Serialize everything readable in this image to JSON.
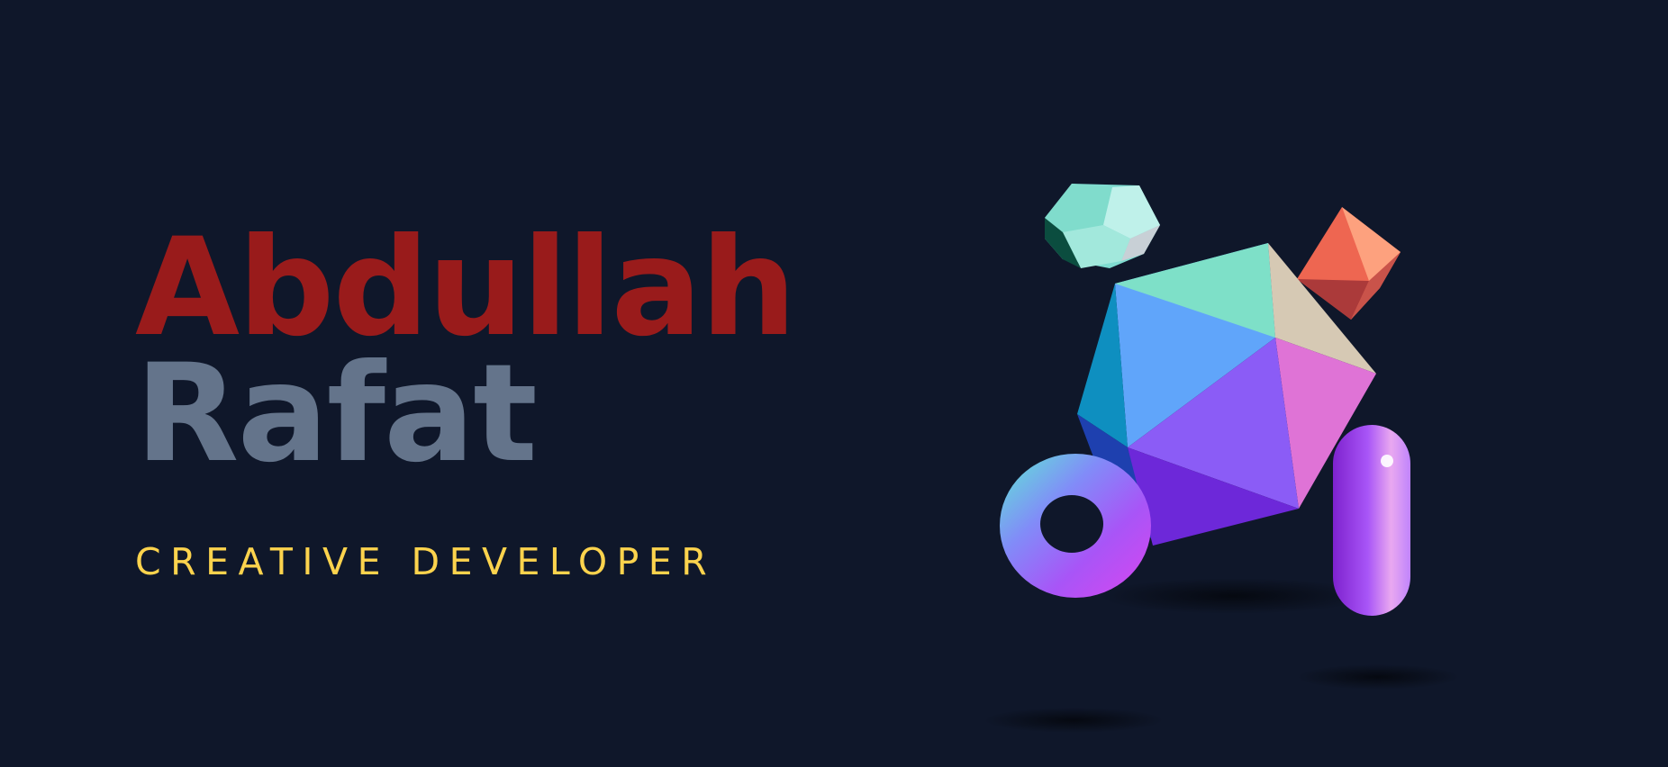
{
  "hero": {
    "first_name": "Abdullah",
    "last_name": "Rafat",
    "tagline": "CREATIVE DEVELOPER"
  },
  "colors": {
    "background": "#0f172a",
    "first_name": "#991b1b",
    "last_name": "#64748b",
    "tagline": "#fcd34d"
  },
  "scene": {
    "objects": [
      "dodecahedron-icon",
      "octahedron-icon",
      "icosahedron-icon",
      "torus-icon",
      "capsule-icon"
    ]
  }
}
